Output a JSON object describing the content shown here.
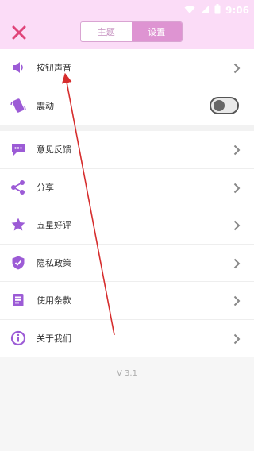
{
  "status_bar": {
    "time": "9:06",
    "icons": [
      "wifi-icon",
      "signal-icon",
      "battery-icon"
    ]
  },
  "header": {
    "close_icon": "close-icon",
    "tabs": [
      {
        "label": "主题"
      },
      {
        "label": "设置"
      }
    ],
    "active_tab": "设置"
  },
  "settings": {
    "group1": [
      {
        "label": "按钮声音",
        "icon": "speaker-icon",
        "control": "chevron"
      },
      {
        "label": "震动",
        "icon": "vibrate-icon",
        "control": "toggle",
        "toggle_on": false
      }
    ],
    "group2": [
      {
        "label": "意见反馈",
        "icon": "feedback-icon"
      },
      {
        "label": "分享",
        "icon": "share-icon"
      },
      {
        "label": "五星好评",
        "icon": "star-icon"
      },
      {
        "label": "隐私政策",
        "icon": "shield-icon"
      },
      {
        "label": "使用条款",
        "icon": "document-icon"
      },
      {
        "label": "关于我们",
        "icon": "info-icon"
      }
    ]
  },
  "version": "V 3.1",
  "colors": {
    "accent": "#9c5bd6",
    "header_bg": "#fbdcf7",
    "tab_active": "#de94d2",
    "close_red": "#e0447a",
    "annotation_arrow": "#d62d2d"
  }
}
